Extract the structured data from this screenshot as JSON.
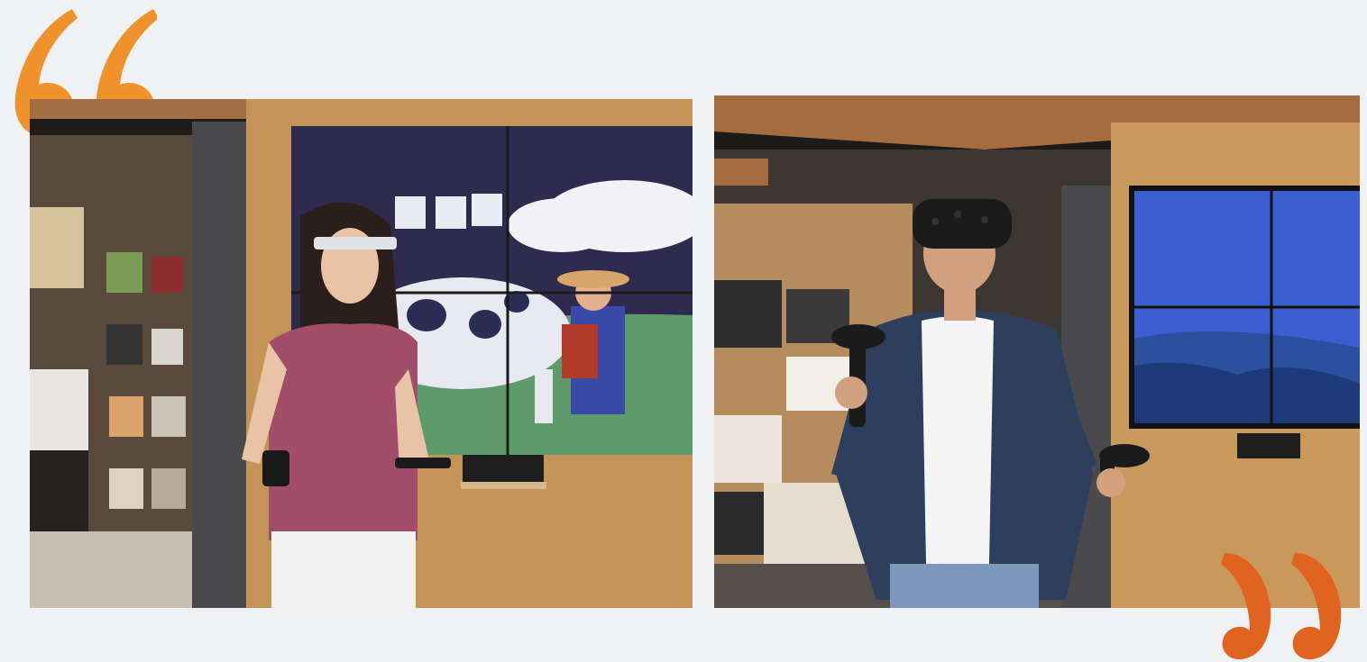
{
  "colors": {
    "background": "#eff1f3",
    "quote_open": "#f0922c",
    "quote_close": "#e0631f",
    "wood_panel": "#c9995c",
    "screen_sky_left": "#2e2b4f",
    "screen_grass_left": "#5d9b6a",
    "screen_ocean_right": "#3b5fd0"
  },
  "icons": {
    "open_quote": "open-quote-icon",
    "close_quote": "close-quote-icon"
  }
}
